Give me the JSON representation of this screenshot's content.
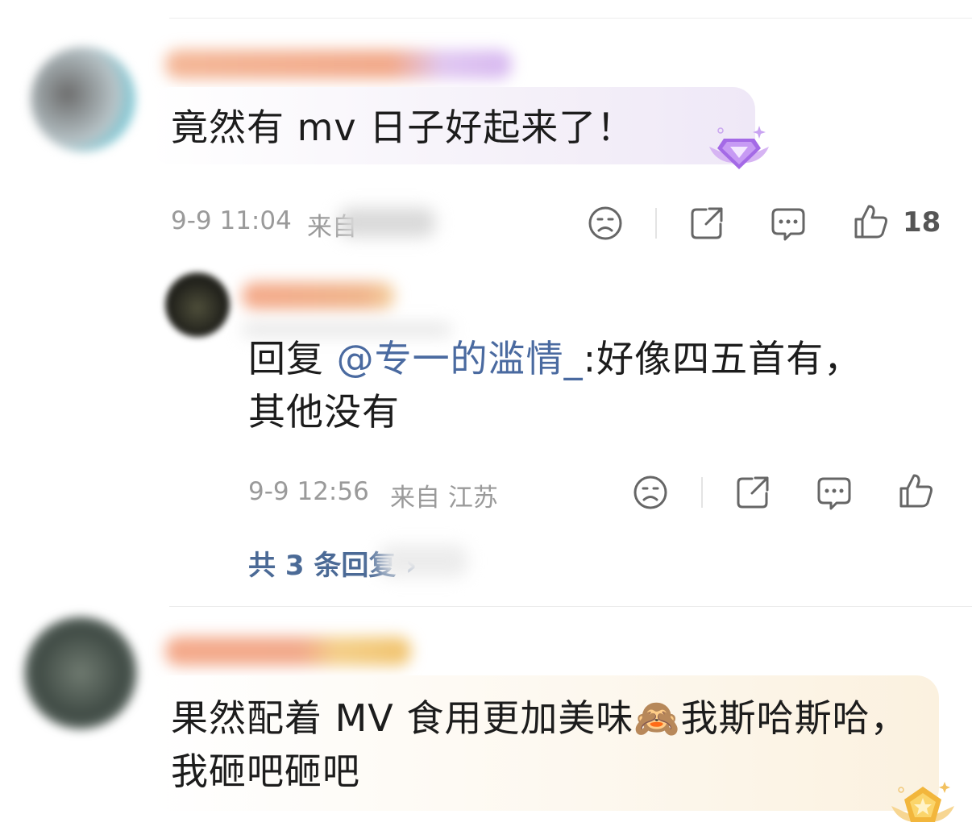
{
  "comments": [
    {
      "text": "竟然有 mv 日子好起来了！",
      "time": "9-9 11:04",
      "location_prefix": "来自",
      "like_count": "18",
      "badge": "purple-gem-badge"
    },
    {
      "text": "果然配着 MV 食用更加美味🙈我斯哈斯哈，我砸吧砸吧",
      "badge": "gold-star-badge"
    }
  ],
  "reply": {
    "prefix": "回复 ",
    "mention": "@专一的滥情_",
    "text": ":好像四五首有，其他没有",
    "time": "9-9 12:56",
    "location": "来自 江苏"
  },
  "more_replies": "共 3 条回复 ›",
  "icons": {
    "dislike": "sad-face-icon",
    "share": "share-icon",
    "comment": "comment-icon",
    "like": "thumbs-up-icon"
  },
  "colors": {
    "mention": "#4a6aa0",
    "meta": "#9a9a9a",
    "bubble_purple": "#f3eef8",
    "bubble_gold": "#fdf6ea"
  }
}
